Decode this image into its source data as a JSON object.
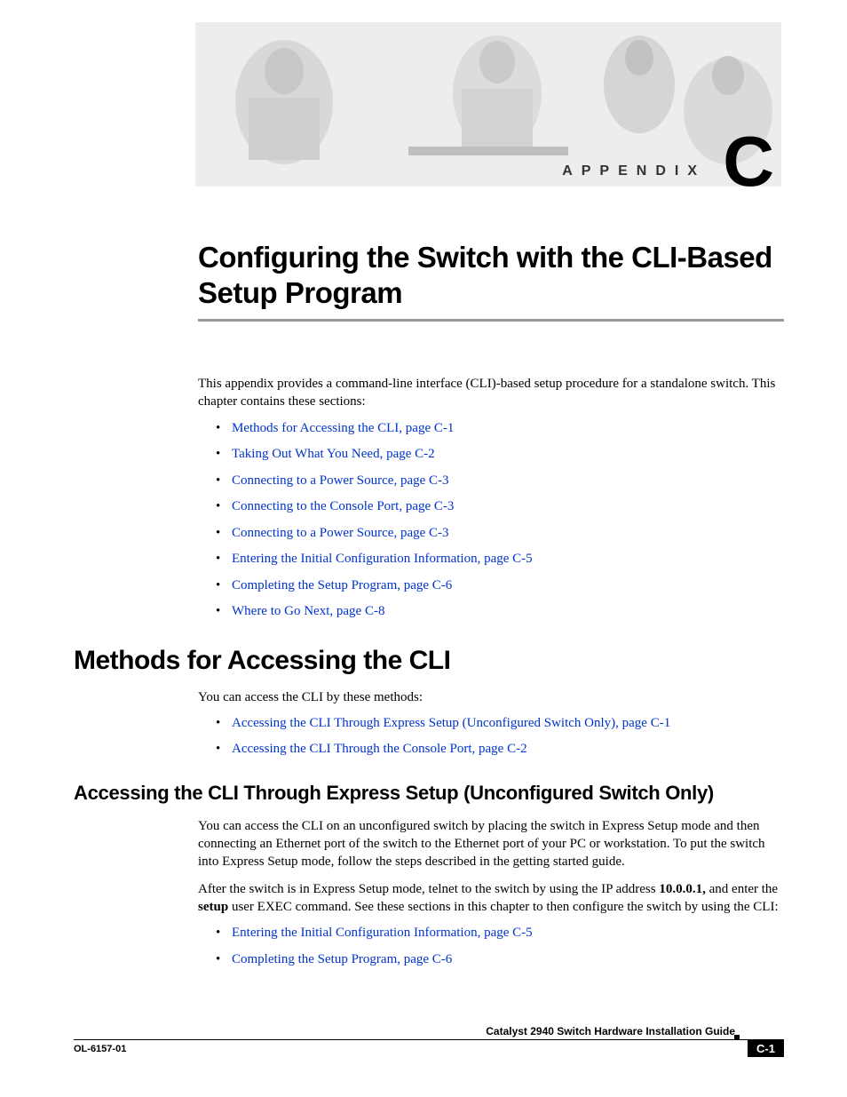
{
  "banner": {
    "label": "APPENDIX",
    "letter": "C"
  },
  "chapter": {
    "title": "Configuring the Switch with the CLI-Based Setup Program",
    "intro": "This appendix provides a command-line interface (CLI)-based setup procedure for a standalone switch. This chapter contains these sections:",
    "toc": [
      "Methods for Accessing the CLI, page C-1",
      "Taking Out What You Need, page C-2",
      "Connecting to a Power Source, page C-3",
      "Connecting to the Console Port, page C-3",
      "Connecting to a Power Source, page C-3",
      "Entering the Initial Configuration Information, page C-5",
      "Completing the Setup Program, page C-6",
      "Where to Go Next, page C-8"
    ]
  },
  "section1": {
    "heading": "Methods for Accessing the CLI",
    "intro": "You can access the CLI by these methods:",
    "links": [
      "Accessing the CLI Through Express Setup (Unconfigured Switch Only), page C-1",
      "Accessing the CLI Through the Console Port, page C-2"
    ]
  },
  "section2": {
    "heading": "Accessing the CLI Through Express Setup (Unconfigured Switch Only)",
    "p1": "You can access the CLI on an unconfigured switch by placing the switch in Express Setup mode and then connecting an Ethernet port of the switch to the Ethernet port of your PC or workstation. To put the switch into Express Setup mode, follow the steps described in the getting started guide.",
    "p2_a": "After the switch is in Express Setup mode, telnet to the switch by using the IP address ",
    "p2_ip": "10.0.0.1,",
    "p2_b": " and enter the ",
    "p2_cmd": "setup",
    "p2_c": " user EXEC command. See these sections in this chapter to then configure the switch by using the CLI:",
    "links": [
      "Entering the Initial Configuration Information, page C-5",
      "Completing the Setup Program, page C-6"
    ]
  },
  "footer": {
    "guide": "Catalyst 2940 Switch Hardware Installation Guide",
    "docnum": "OL-6157-01",
    "page": "C-1"
  }
}
